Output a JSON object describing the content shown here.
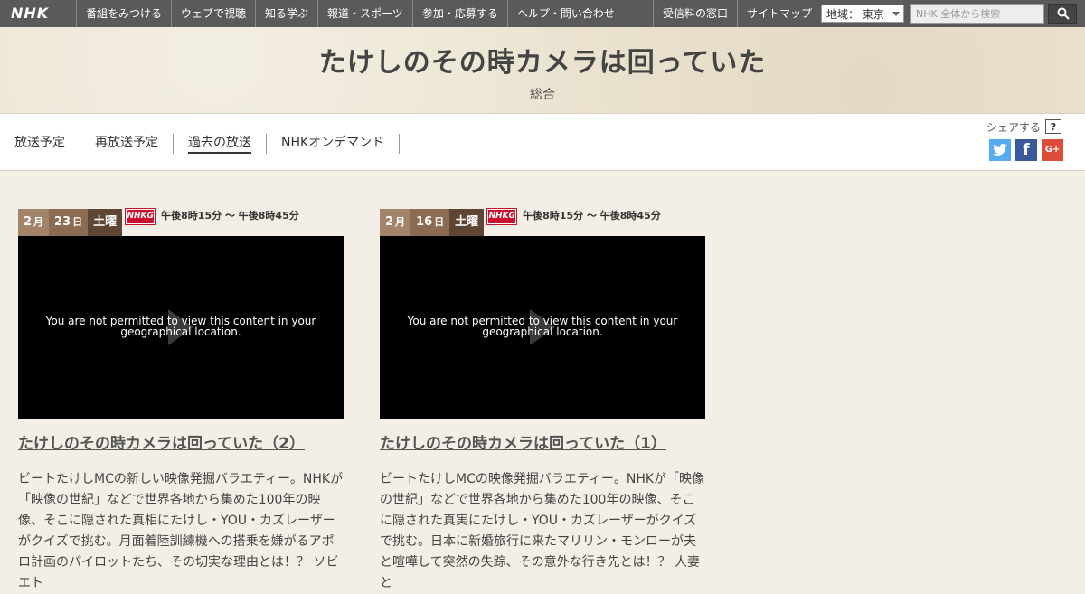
{
  "topbar": {
    "logo": "NHK",
    "nav": [
      "番組をみつける",
      "ウェブで視聴",
      "知る学ぶ",
      "報道・スポーツ",
      "参加・応募する",
      "ヘルプ・問い合わせ"
    ],
    "right_links": [
      "受信料の窓口",
      "サイトマップ"
    ],
    "region_label": "地域： 東京",
    "search_placeholder": "NHK 全体から検索"
  },
  "header": {
    "title": "たけしのその時カメラは回っていた",
    "channel": "総合"
  },
  "subnav": {
    "tabs": [
      {
        "label": "放送予定",
        "active": false
      },
      {
        "label": "再放送予定",
        "active": false
      },
      {
        "label": "過去の放送",
        "active": true
      },
      {
        "label": "NHKオンデマンド",
        "active": false
      }
    ],
    "share_label": "シェアする",
    "share_help": "?",
    "share_buttons": {
      "twitter": "t",
      "facebook": "f",
      "google": "G+"
    }
  },
  "episodes": [
    {
      "month": "2",
      "month_unit": "月",
      "day": "23",
      "day_unit": "日",
      "weekday": "土曜",
      "channel_logo": "NHKG",
      "time": "午後8時15分 ～ 午後8時45分",
      "video_message": "You are not permitted to view this content in your geographical location.",
      "title": "たけしのその時カメラは回っていた（2）",
      "description": "ビートたけしMCの新しい映像発掘バラエティー。NHKが「映像の世紀」などで世界各地から集めた100年の映像、そこに隠された真相にたけし・YOU・カズレーザーがクイズで挑む。月面着陸訓練機への搭乗を嫌がるアポロ計画のパイロットたち、その切実な理由とは！？ ソビエト"
    },
    {
      "month": "2",
      "month_unit": "月",
      "day": "16",
      "day_unit": "日",
      "weekday": "土曜",
      "channel_logo": "NHKG",
      "time": "午後8時15分 ～ 午後8時45分",
      "video_message": "You are not permitted to view this content in your geographical location.",
      "title": "たけしのその時カメラは回っていた（1）",
      "description": "ビートたけしMCの映像発掘バラエティー。NHKが「映像の世紀」などで世界各地から集めた100年の映像、そこに隠された真実にたけし・YOU・カズレーザーがクイズで挑む。日本に新婚旅行に来たマリリン・モンローが夫と喧嘩して突然の失踪、その意外な行き先とは！？ 人妻と"
    }
  ]
}
